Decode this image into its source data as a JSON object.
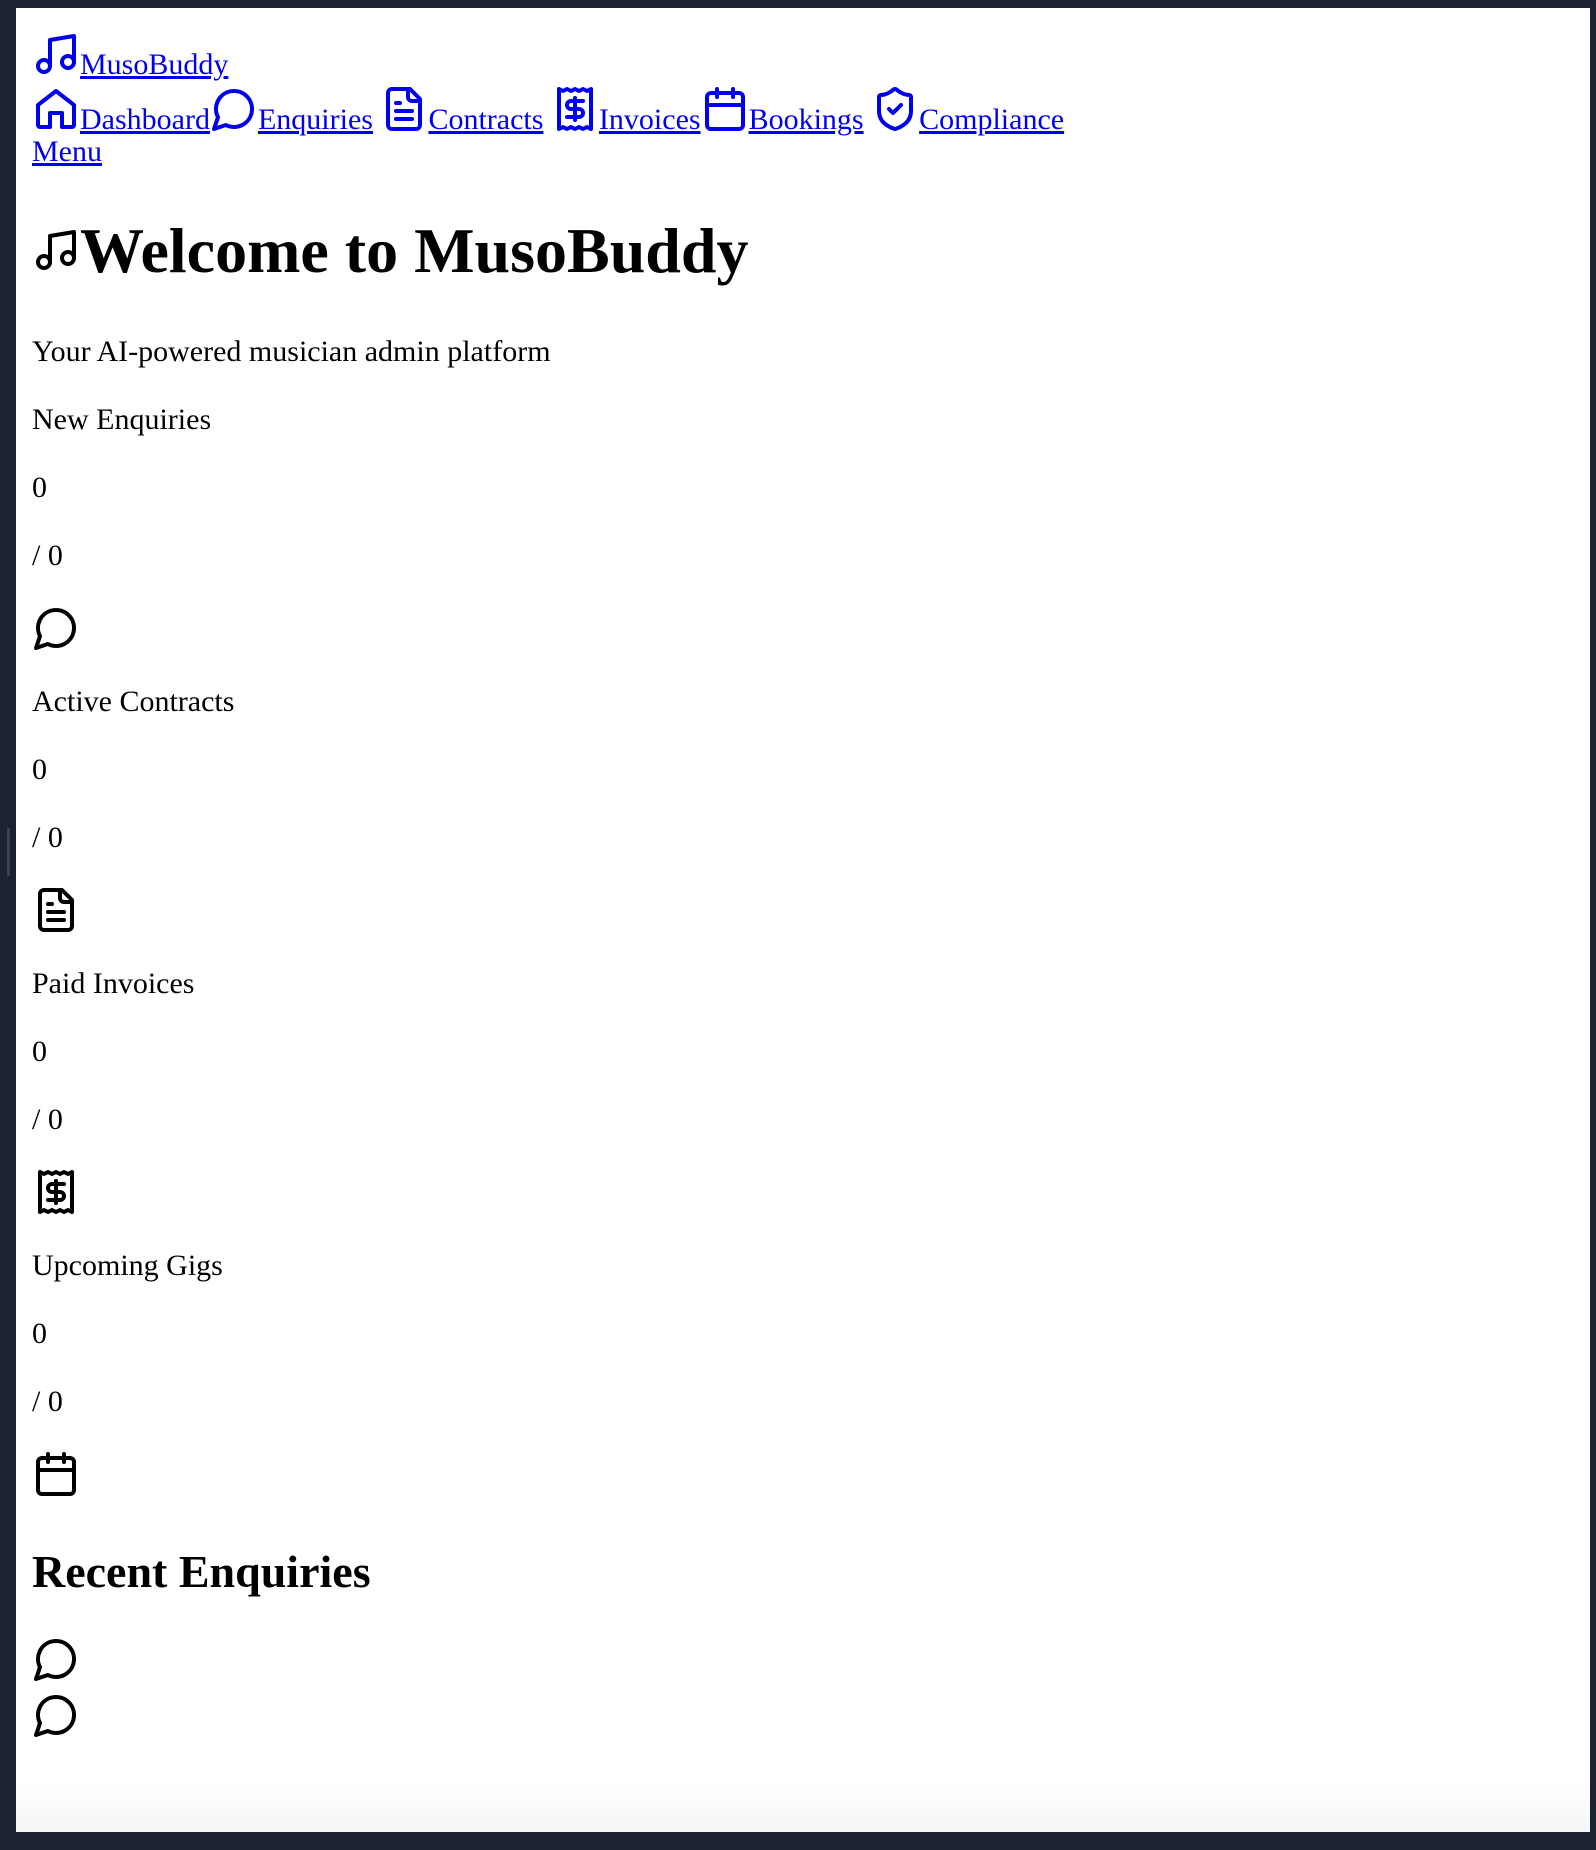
{
  "header": {
    "brand": "MusoBuddy",
    "brand_icon": "music-note-icon",
    "nav": [
      {
        "label": "Dashboard",
        "icon": "home-icon"
      },
      {
        "label": "Enquiries",
        "icon": "chat-bubble-icon"
      },
      {
        "label": "Contracts",
        "icon": "document-icon"
      },
      {
        "label": "Invoices",
        "icon": "receipt-dollar-icon"
      },
      {
        "label": "Bookings",
        "icon": "calendar-icon"
      },
      {
        "label": "Compliance",
        "icon": "shield-check-icon"
      }
    ],
    "menu_label": "Menu"
  },
  "main": {
    "title": "Welcome to MusoBuddy",
    "title_icon": "music-note-icon",
    "subtitle": "Your AI-powered musician admin platform",
    "stats": [
      {
        "label": "New Enquiries",
        "value": "0",
        "total": "/ 0",
        "icon": "chat-bubble-icon"
      },
      {
        "label": "Active Contracts",
        "value": "0",
        "total": "/ 0",
        "icon": "document-icon"
      },
      {
        "label": "Paid Invoices",
        "value": "0",
        "total": "/ 0",
        "icon": "receipt-dollar-icon"
      },
      {
        "label": "Upcoming Gigs",
        "value": "0",
        "total": "/ 0",
        "icon": "calendar-icon"
      }
    ],
    "recent": {
      "title": "Recent Enquiries",
      "items": [
        {
          "icon": "chat-bubble-icon"
        },
        {
          "icon": "chat-bubble-icon"
        }
      ]
    }
  },
  "colors": {
    "link": "#0000ee",
    "text": "#000000",
    "background": "#ffffff",
    "frame": "#1b2231"
  }
}
